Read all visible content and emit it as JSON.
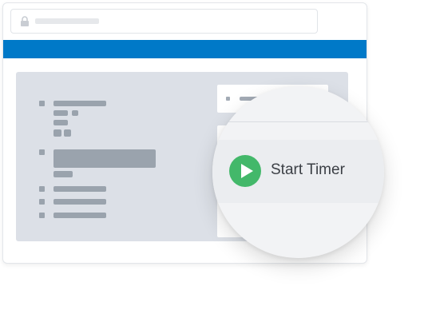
{
  "browser": {
    "accent_color": "#0079c8",
    "address_icon": "lock-icon"
  },
  "timer": {
    "start_label": "Start Timer",
    "button_icon": "play-icon",
    "button_color": "#43b86a"
  }
}
